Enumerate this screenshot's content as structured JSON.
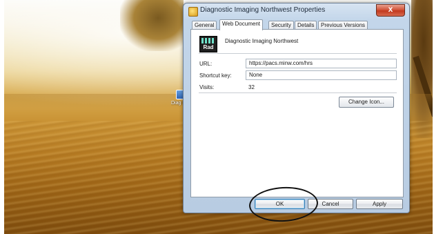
{
  "dialog": {
    "title": "Diagnostic Imaging Northwest Properties",
    "close_label": "x",
    "tabs": [
      {
        "label": "General",
        "active": false
      },
      {
        "label": "Web Document",
        "active": true
      },
      {
        "label": "Security",
        "active": false
      },
      {
        "label": "Details",
        "active": false
      },
      {
        "label": "Previous Versions",
        "active": false
      }
    ],
    "document": {
      "name": "Diagnostic Imaging Northwest",
      "icon_text": "Rad",
      "icon": "rad-app-icon"
    },
    "fields": {
      "url_label": "URL:",
      "url_value": "https://pacs.minw.com/hrs",
      "shortcut_label": "Shortcut key:",
      "shortcut_value": "None",
      "visits_label": "Visits:",
      "visits_value": "32"
    },
    "change_icon_label": "Change Icon...",
    "buttons": {
      "ok": "OK",
      "cancel": "Cancel",
      "apply": "Apply"
    }
  },
  "desktop": {
    "icon_label": "Diag Imag"
  },
  "colors": {
    "close_button": "#c23a1f",
    "dialog_frame": "#c3d6ea",
    "annotation": "#111111"
  }
}
